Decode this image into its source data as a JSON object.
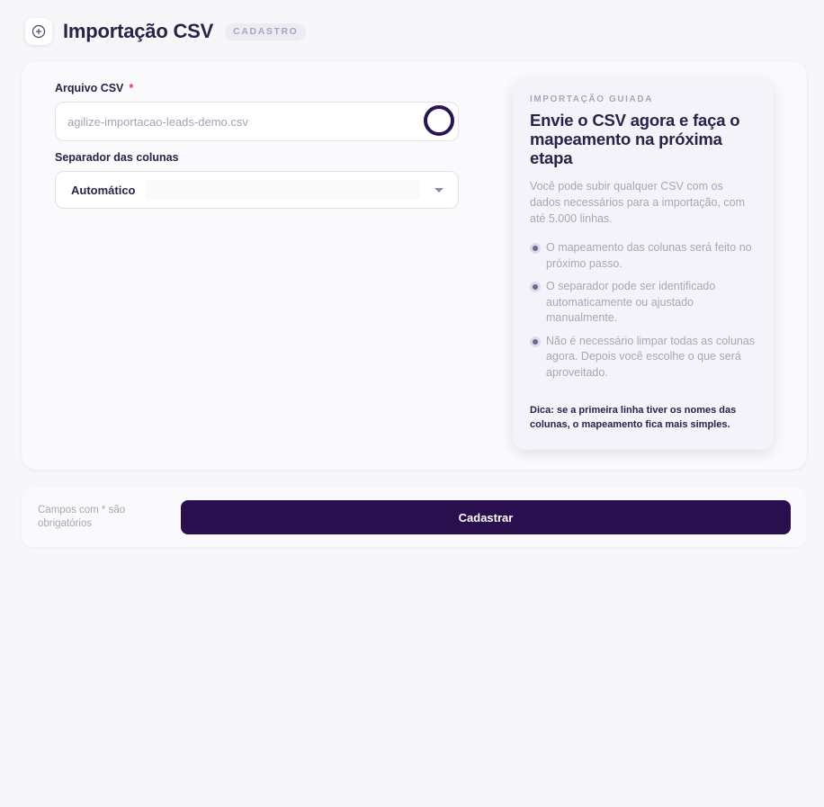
{
  "header": {
    "title": "Importação CSV",
    "badge": "CADASTRO",
    "add_icon": "plus-circle-icon"
  },
  "form": {
    "file_label": "Arquivo CSV",
    "required_mark": "*",
    "file_value": "agilize-importacao-leads-demo.csv",
    "separator_label": "Separador das colunas",
    "separator_value": "Automático"
  },
  "panel": {
    "eyebrow": "IMPORTAÇÃO GUIADA",
    "title": "Envie o CSV agora e faça o mapeamento na próxima etapa",
    "description": "Você pode subir qualquer CSV com os dados necessários para a importação, com até 5.000 linhas.",
    "bullets": [
      "O mapeamento das colunas será feito no próximo passo.",
      "O separador pode ser identificado automaticamente ou ajustado manualmente.",
      "Não é necessário limpar todas as colunas agora. Depois você escolhe o que será aproveitado."
    ],
    "tip": "Dica: se a primeira linha tiver os nomes das colunas, o mapeamento fica mais simples."
  },
  "footer": {
    "note": "Campos com * são obrigatórios",
    "submit_label": "Cadastrar"
  },
  "colors": {
    "primary": "#2a0f4f",
    "required": "#e0334a",
    "background": "#f7f7fa"
  }
}
